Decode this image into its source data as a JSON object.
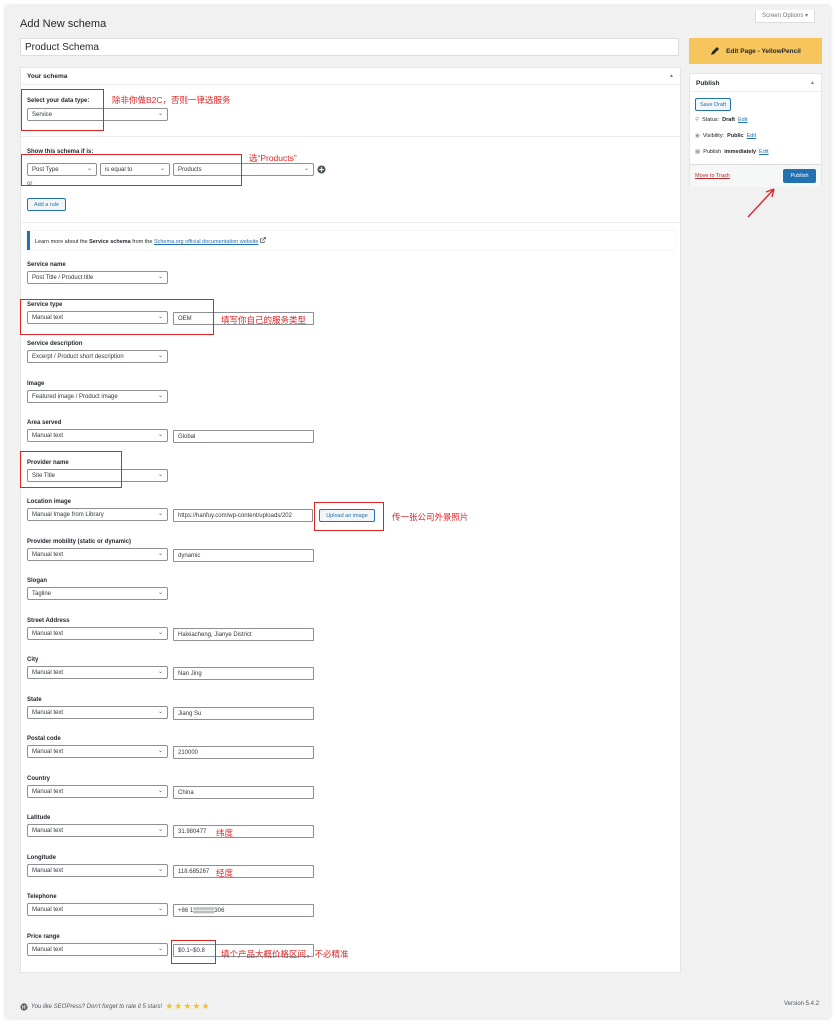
{
  "page": {
    "title": "Add New schema",
    "screen_options": "Screen Options ▾",
    "schema_title": "Product Schema",
    "yellowpencil_label": "Edit Page - YellowPencil"
  },
  "schema_box": {
    "header": "Your schema",
    "data_type_label": "Select your data type:",
    "data_type_value": "Service",
    "show_if_label": "Show this schema if is:",
    "rule_type": "Post Type",
    "rule_operator": "is equal to",
    "rule_value": "Products",
    "or_label": "or",
    "add_rule": "Add a rule",
    "info_prefix": "Learn more about the ",
    "info_bold": "Service schema",
    "info_mid": " from the ",
    "info_link": "Schema.org official documentation website"
  },
  "fields": [
    {
      "label": "Service name",
      "select": "Post Title / Product title",
      "text": null
    },
    {
      "label": "Service type",
      "select": "Manual text",
      "text": "OEM"
    },
    {
      "label": "Service description",
      "select": "Excerpt / Product short description",
      "text": null
    },
    {
      "label": "Image",
      "select": "Featured image / Product image",
      "text": null
    },
    {
      "label": "Area served",
      "select": "Manual text",
      "text": "Global"
    },
    {
      "label": "Provider name",
      "select": "Site Title",
      "text": null
    },
    {
      "label": "Location image",
      "select": "Manual Image from Library",
      "text": "https://hanfuy.com/wp-content/uploads/202"
    },
    {
      "label": "Provider mobility (static or dynamic)",
      "select": "Manual text",
      "text": "dynamic"
    },
    {
      "label": "Slogan",
      "select": "Tagline",
      "text": null
    },
    {
      "label": "Street Address",
      "select": "Manual text",
      "text": "Haixiacheng, Jianye District"
    },
    {
      "label": "City",
      "select": "Manual text",
      "text": "Nan Jing"
    },
    {
      "label": "State",
      "select": "Manual text",
      "text": "Jiang Su"
    },
    {
      "label": "Postal code",
      "select": "Manual text",
      "text": "210000"
    },
    {
      "label": "Country",
      "select": "Manual text",
      "text": "China"
    },
    {
      "label": "Latitude",
      "select": "Manual text",
      "text": "31.980477"
    },
    {
      "label": "Longitude",
      "select": "Manual text",
      "text": "118.685267"
    },
    {
      "label": "Telephone",
      "select": "Manual text",
      "text": "+86 1▒▒▒▒▒306"
    },
    {
      "label": "Price range",
      "select": "Manual text",
      "text": "$0.1~$0.8"
    }
  ],
  "upload_button": "Upload an image",
  "annotations": {
    "data_type": "除非你做B2C，否则一律选服务",
    "products": "选“Products”",
    "service_type": "填写你自己的服务类型",
    "location_image": "传一张公司外景照片",
    "latitude": "纬度",
    "longitude": "经度",
    "price_range": "填个产品大概价格区间，不必精准"
  },
  "annotation_color": "#e02424",
  "publish": {
    "header": "Publish",
    "save_draft": "Save Draft",
    "status_label": "Status: ",
    "status_value": "Draft",
    "visibility_label": "Visibility: ",
    "visibility_value": "Public",
    "publish_label": "Publish ",
    "publish_value": "immediately",
    "edit": "Edit",
    "trash": "Move to Trash",
    "publish_button": "Publish"
  },
  "footer": {
    "left": "You like SEOPress? Don't forget to rate it 5 stars!",
    "stars": "★★★★★",
    "version": "Version 5.4.2"
  },
  "icons": {
    "yellowpencil": "pencil-icon",
    "add_rule_plus": "plus-circle-icon",
    "external": "external-link-icon",
    "status": "pin-icon",
    "visibility": "eye-icon",
    "calendar": "calendar-icon",
    "wordpress": "wordpress-icon"
  }
}
